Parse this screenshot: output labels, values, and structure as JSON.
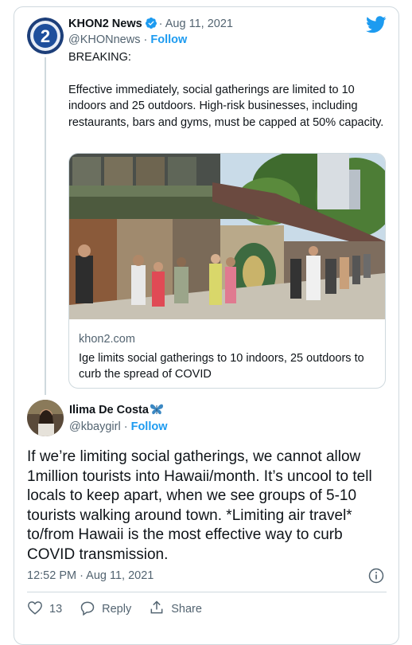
{
  "tweet": {
    "author_name": "KHON2 News",
    "verified": true,
    "dot": "·",
    "date": "Aug 11, 2021",
    "handle": "@KHONnews",
    "follow_label": "Follow",
    "text_heading": "BREAKING:",
    "text_body": "Effective immediately, social gatherings are limited to 10 indoors and 25 outdoors. High-risk businesses, including restaurants, bars and gyms, must be capped at 50% capacity.",
    "link_card": {
      "domain": "khon2.com",
      "title": "Ige limits social gatherings to 10 indoors, 25 outdoors to curb the spread of COVID"
    }
  },
  "reply": {
    "author_name": "Ilima De Costa",
    "handle": "@kbaygirl",
    "follow_label": "Follow",
    "text": "If we’re limiting social gatherings, we cannot allow 1million tourists into Hawaii/month. It’s uncool to tell locals to keep apart, when we see groups of 5-10 tourists walking around town. *Limiting air travel* to/from Hawaii is the most effective way to curb COVID transmission.",
    "timestamp": "12:52 PM · Aug 11, 2021",
    "like_count": "13",
    "reply_label": "Reply",
    "share_label": "Share"
  },
  "colors": {
    "accent": "#1d9bf0",
    "text": "#0f1419",
    "muted": "#536471",
    "border": "#cfd9de"
  },
  "icons": [
    "khon2-logo",
    "verified-badge-icon",
    "twitter-bird-icon",
    "butterfly-emoji",
    "info-icon",
    "heart-icon",
    "reply-bubble-icon",
    "share-icon"
  ]
}
